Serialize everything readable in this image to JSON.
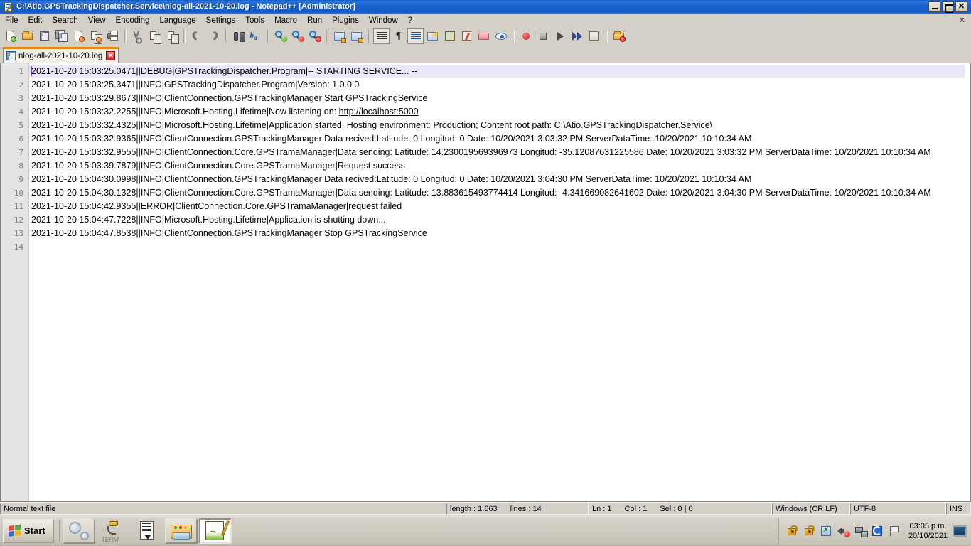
{
  "window": {
    "title": "C:\\Atio.GPSTrackingDispatcher.Service\\nlog-all-2021-10-20.log - Notepad++ [Administrator]",
    "minimize_label": "",
    "restore_label": "",
    "close_label": "✕"
  },
  "menu": {
    "items": [
      {
        "label": "File"
      },
      {
        "label": "Edit"
      },
      {
        "label": "Search"
      },
      {
        "label": "View"
      },
      {
        "label": "Encoding"
      },
      {
        "label": "Language"
      },
      {
        "label": "Settings"
      },
      {
        "label": "Tools"
      },
      {
        "label": "Macro"
      },
      {
        "label": "Run"
      },
      {
        "label": "Plugins"
      },
      {
        "label": "Window"
      },
      {
        "label": "?"
      }
    ],
    "close_doc_label": "✕"
  },
  "toolbar": {
    "buttons": [
      {
        "name": "new-file-icon"
      },
      {
        "name": "open-file-icon"
      },
      {
        "name": "save-icon"
      },
      {
        "name": "save-all-icon"
      },
      {
        "name": "close-file-icon"
      },
      {
        "name": "close-all-icon"
      },
      {
        "name": "print-icon"
      },
      {
        "name": "cut-icon"
      },
      {
        "name": "copy-icon"
      },
      {
        "name": "paste-icon"
      },
      {
        "name": "undo-icon"
      },
      {
        "name": "redo-icon"
      },
      {
        "name": "find-icon"
      },
      {
        "name": "replace-icon"
      },
      {
        "name": "zoom-in-icon"
      },
      {
        "name": "zoom-out-icon"
      },
      {
        "name": "sync-vertical-scroll-icon"
      },
      {
        "name": "sync-horizontal-scroll-icon"
      },
      {
        "name": "word-wrap-icon"
      },
      {
        "name": "show-all-chars-icon"
      },
      {
        "name": "indent-guide-icon"
      },
      {
        "name": "user-defined-dialog-icon"
      },
      {
        "name": "document-map-icon"
      },
      {
        "name": "function-list-icon"
      },
      {
        "name": "folder-as-workspace-icon"
      },
      {
        "name": "monitoring-icon"
      },
      {
        "name": "record-macro-icon"
      },
      {
        "name": "stop-recording-icon"
      },
      {
        "name": "play-macro-icon"
      },
      {
        "name": "run-macro-multiple-icon"
      },
      {
        "name": "save-macro-icon"
      },
      {
        "name": "run-icon"
      }
    ]
  },
  "tab": {
    "label": "nlog-all-2021-10-20.log",
    "close_label": "✕"
  },
  "editor": {
    "line_numbers": [
      "1",
      "2",
      "3",
      "4",
      "5",
      "6",
      "7",
      "8",
      "9",
      "10",
      "11",
      "12",
      "13",
      "14"
    ],
    "current_line": 1,
    "lines": [
      "2021-10-20 15:03:25.0471||DEBUG|GPSTrackingDispatcher.Program|-- STARTING SERVICE... --",
      "2021-10-20 15:03:25.3471||INFO|GPSTrackingDispatcher.Program|Version: 1.0.0.0",
      "2021-10-20 15:03:29.8673||INFO|ClientConnection.GPSTrackingManager|Start GPSTrackingService",
      "2021-10-20 15:03:32.2255||INFO|Microsoft.Hosting.Lifetime|Now listening on: http://localhost:5000",
      "2021-10-20 15:03:32.4325||INFO|Microsoft.Hosting.Lifetime|Application started. Hosting environment: Production; Content root path: C:\\Atio.GPSTrackingDispatcher.Service\\",
      "2021-10-20 15:03:32.9365||INFO|ClientConnection.GPSTrackingManager|Data recived:Latitude: 0 Longitud: 0 Date: 10/20/2021 3:03:32 PM ServerDataTime: 10/20/2021 10:10:34 AM",
      "2021-10-20 15:03:32.9555||INFO|ClientConnection.Core.GPSTramaManager|Data sending: Latitude: 14.230019569396973 Longitud: -35.12087631225586 Date: 10/20/2021 3:03:32 PM ServerDataTime: 10/20/2021 10:10:34 AM",
      "2021-10-20 15:03:39.7879||INFO|ClientConnection.Core.GPSTramaManager|Request success",
      "2021-10-20 15:04:30.0998||INFO|ClientConnection.GPSTrackingManager|Data recived:Latitude: 0 Longitud: 0 Date: 10/20/2021 3:04:30 PM ServerDataTime: 10/20/2021 10:10:34 AM",
      "2021-10-20 15:04:30.1328||INFO|ClientConnection.Core.GPSTramaManager|Data sending: Latitude: 13.883615493774414 Longitud: -4.341669082641602 Date: 10/20/2021 3:04:30 PM ServerDataTime: 10/20/2021 10:10:34 AM",
      "2021-10-20 15:04:42.9355||ERROR|ClientConnection.Core.GPSTramaManager|request failed",
      "2021-10-20 15:04:47.7228||INFO|Microsoft.Hosting.Lifetime|Application is shutting down...",
      "2021-10-20 15:04:47.8538||INFO|ClientConnection.GPSTrackingManager|Stop GPSTrackingService",
      ""
    ],
    "line4_prefix": "2021-10-20 15:03:32.2255||INFO|Microsoft.Hosting.Lifetime|Now listening on: ",
    "line4_url": "http://localhost:5000"
  },
  "statusbar": {
    "file_type": "Normal text file",
    "length": "length : 1.663",
    "lines": "lines : 14",
    "ln": "Ln : 1",
    "col": "Col : 1",
    "sel": "Sel : 0 | 0",
    "eol": "Windows (CR LF)",
    "encoding": "UTF-8",
    "insert_mode": "INS"
  },
  "taskbar": {
    "start_label": "Start",
    "quick_launch": [
      {
        "name": "settings-gears-icon"
      },
      {
        "name": "term-icon",
        "label": "TERM"
      },
      {
        "name": "document-download-icon"
      },
      {
        "name": "file-explorer-icon"
      },
      {
        "name": "notepadpp-icon"
      }
    ],
    "tray": [
      {
        "name": "security-lock-icon"
      },
      {
        "name": "security-lock-alt-icon"
      },
      {
        "name": "excel-tray-icon"
      },
      {
        "name": "volume-muted-icon"
      },
      {
        "name": "network-icon"
      },
      {
        "name": "update-icon"
      },
      {
        "name": "flag-icon"
      }
    ],
    "clock_time": "03:05 p.m.",
    "clock_date": "20/10/2021"
  },
  "colors": {
    "title_blue": "#1c63ce",
    "chrome": "#d4d0c8",
    "tab_active_top": "#e8840c",
    "current_line": "#e8e8f8",
    "caret": "#7a33cc"
  }
}
